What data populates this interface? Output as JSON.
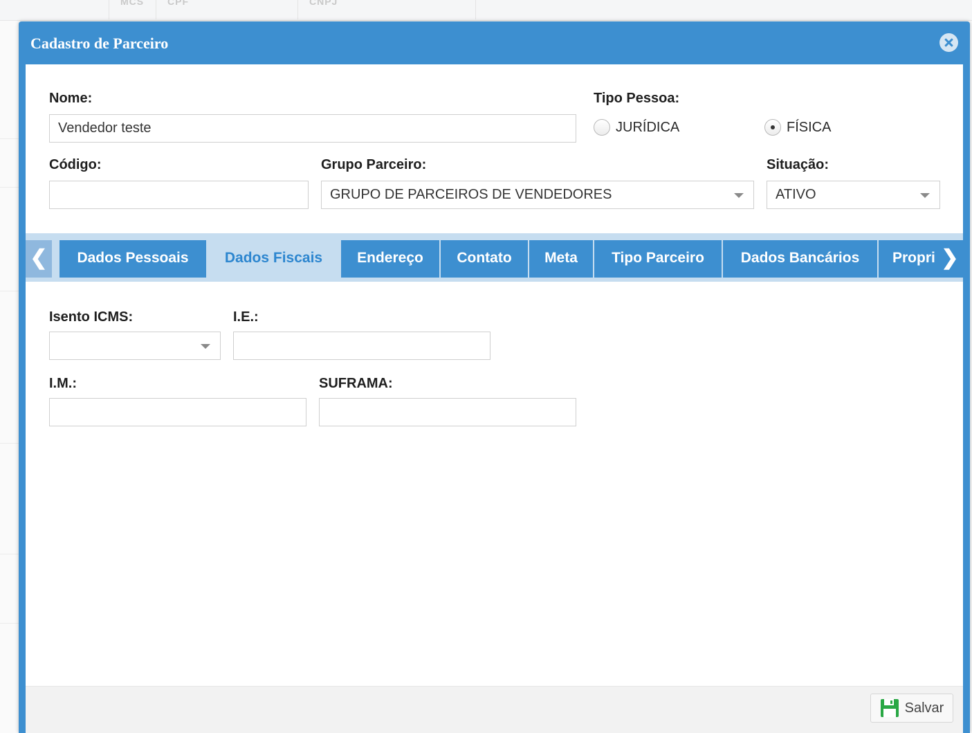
{
  "background": {
    "columns": [
      "MCS",
      "CPF",
      "CNPJ"
    ]
  },
  "modal": {
    "title": "Cadastro de Parceiro"
  },
  "form": {
    "nome": {
      "label": "Nome:",
      "value": "Vendedor teste"
    },
    "tipo_pessoa": {
      "label": "Tipo Pessoa:",
      "options": [
        "JURÍDICA",
        "FÍSICA"
      ],
      "selected": "FÍSICA"
    },
    "codigo": {
      "label": "Código:",
      "value": ""
    },
    "grupo_parceiro": {
      "label": "Grupo Parceiro:",
      "value": "GRUPO DE PARCEIROS DE VENDEDORES"
    },
    "situacao": {
      "label": "Situação:",
      "value": "ATIVO"
    }
  },
  "tabs": [
    {
      "label": "Dados Pessoais",
      "active": false
    },
    {
      "label": "Dados Fiscais",
      "active": true
    },
    {
      "label": "Endereço",
      "active": false
    },
    {
      "label": "Contato",
      "active": false
    },
    {
      "label": "Meta",
      "active": false
    },
    {
      "label": "Tipo Parceiro",
      "active": false
    },
    {
      "label": "Dados Bancários",
      "active": false
    },
    {
      "label": "Propri",
      "active": false
    }
  ],
  "tab_nav": {
    "prev": "❮",
    "next": "❯"
  },
  "fiscal": {
    "isento_icms": {
      "label": "Isento ICMS:",
      "value": ""
    },
    "ie": {
      "label": "I.E.:",
      "value": ""
    },
    "im": {
      "label": "I.M.:",
      "value": ""
    },
    "suframa": {
      "label": "SUFRAMA:",
      "value": ""
    }
  },
  "footer": {
    "save_label": "Salvar"
  },
  "colors": {
    "header_blue": "#3d8fd0",
    "tab_active_bg": "#c6ddf0",
    "annotation_arrow": "#d41f24",
    "save_icon": "#2aa845"
  },
  "icons": {
    "close": "close-circle-icon",
    "save": "floppy-disk-icon",
    "annotation": "red-arrow-left-icon"
  }
}
